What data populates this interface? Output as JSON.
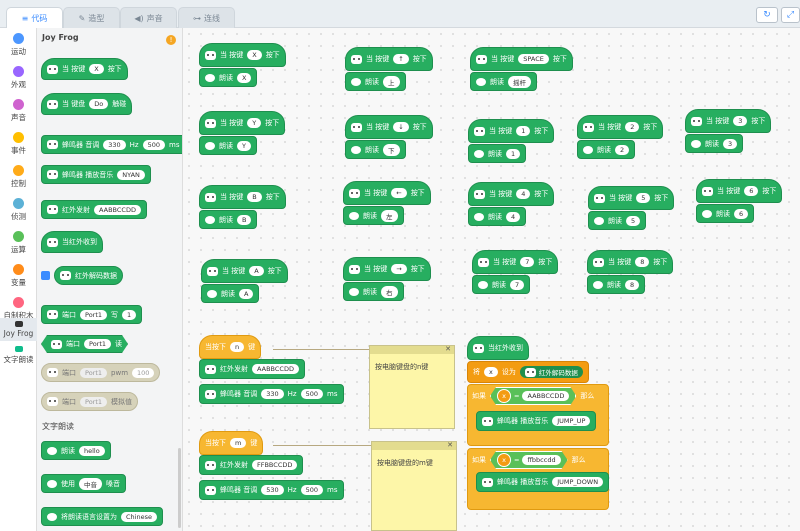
{
  "tabs": [
    "代码",
    "造型",
    "声音",
    "连线"
  ],
  "categories": [
    {
      "label": "运动",
      "color": "#4c97ff"
    },
    {
      "label": "外观",
      "color": "#9966ff"
    },
    {
      "label": "声音",
      "color": "#cf63cf"
    },
    {
      "label": "事件",
      "color": "#ffbf00"
    },
    {
      "label": "控制",
      "color": "#ffab19"
    },
    {
      "label": "侦测",
      "color": "#5cb1d6"
    },
    {
      "label": "运算",
      "color": "#59c059"
    },
    {
      "label": "变量",
      "color": "#ff8c1a"
    },
    {
      "label": "自制积木",
      "color": "#ff6680"
    },
    {
      "label": "Joy Frog",
      "color": "#333333"
    },
    {
      "label": "文字朗读",
      "color": "#0fbd8c"
    }
  ],
  "palette": {
    "title": "Joy Frog",
    "key_block": {
      "when": "当 按键",
      "key": "X",
      "press": "按下"
    },
    "pad_block": {
      "when": "当 键盘",
      "key": "Do",
      "touch": "触碰"
    },
    "tone_block": {
      "label": "蜂鸣器 音调",
      "hz": "330",
      "hz_unit": "Hz",
      "ms": "500",
      "ms_unit": "ms"
    },
    "music_block": {
      "label": "蜂鸣器 播放音乐",
      "song": "NYAN"
    },
    "ir_send": {
      "label": "红外发射",
      "code": "AABBCCDD"
    },
    "ir_recv": {
      "label": "当红外收到"
    },
    "ir_data": {
      "label": "红外解码数据"
    },
    "port_write": {
      "label": "端口",
      "port": "Port1",
      "write": "写",
      "val": "1"
    },
    "port_read": {
      "label": "端口",
      "port": "Port1",
      "read": "读"
    },
    "port_pwm": {
      "label": "端口",
      "port": "Port1",
      "pwm": "pwm",
      "val": "100"
    },
    "port_analog": {
      "label": "端口",
      "port": "Port1",
      "analog": "模拟值"
    },
    "tts_title": "文字朗读",
    "tts_say": {
      "label": "朗读",
      "text": "hello"
    },
    "tts_use": {
      "label": "使用",
      "voice": "中音",
      "tail": "嗓音"
    },
    "tts_lang": {
      "label": "将朗读语言设置为",
      "lang": "Chinese"
    }
  },
  "script": {
    "when_key": "当 按键",
    "press": "按下",
    "read": "朗读",
    "keys": [
      {
        "key": "X",
        "say": "X"
      },
      {
        "key": "↑",
        "say": "上"
      },
      {
        "key": "SPACE",
        "say": "摇杆"
      },
      {
        "key": "Y",
        "say": "Y"
      },
      {
        "key": "↓",
        "say": "下"
      },
      {
        "key": "1",
        "say": "1"
      },
      {
        "key": "2",
        "say": "2"
      },
      {
        "key": "3",
        "say": "3"
      },
      {
        "key": "B",
        "say": "B"
      },
      {
        "key": "←",
        "say": "左"
      },
      {
        "key": "4",
        "say": "4"
      },
      {
        "key": "5",
        "say": "5"
      },
      {
        "key": "6",
        "say": "6"
      },
      {
        "key": "A",
        "say": "A"
      },
      {
        "key": "→",
        "say": "右"
      },
      {
        "key": "7",
        "say": "7"
      },
      {
        "key": "8",
        "say": "8"
      }
    ],
    "pressed": "当按下",
    "key_word": "键",
    "n_key": "n",
    "m_key": "m",
    "ir_send": "红外发射",
    "code1": "AABBCCDD",
    "code2": "FFBBCCDD",
    "tone": "蜂鸣器 音调",
    "hz": "330",
    "hz2": "530",
    "hz_unit": "Hz",
    "ms": "500",
    "ms_unit": "ms",
    "note1": "按电脑键盘的n键",
    "note2": "按电脑键盘的m键",
    "ir_recv": "当红外收到",
    "set_word": "将",
    "var": "x",
    "set_to": "设为",
    "ir_data": "红外解码数据",
    "if_word": "如果",
    "eq": "=",
    "then": "那么",
    "x": "x",
    "cmp1": "AABBCCDD",
    "cmp2": "ffbbccdd",
    "music": "蜂鸣器 播放音乐",
    "song1": "JUMP_UP",
    "song2": "JUMP_DOWN"
  }
}
